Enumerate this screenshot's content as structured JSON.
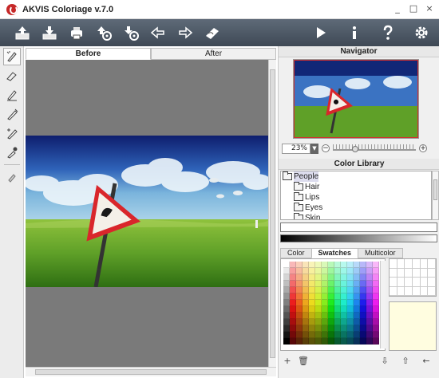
{
  "window": {
    "title": "AKVIS Coloriage v.7.0",
    "min": "_",
    "max": "□",
    "close": "×"
  },
  "toolbar": {
    "left_icons": [
      "open-image-icon",
      "save-image-icon",
      "print-icon",
      "export-icon",
      "settings-export-icon",
      "undo-icon",
      "redo-icon",
      "eraser-icon"
    ],
    "right_icons": [
      "run-icon",
      "info-icon",
      "help-icon",
      "preferences-icon"
    ]
  },
  "tools": [
    "magic-pencil-icon",
    "eraser-tool-icon",
    "pencil-tool-icon",
    "color-brush-icon",
    "smart-brush-icon",
    "eyedropper-icon",
    "hand-tool-icon"
  ],
  "tabs": {
    "before": "Before",
    "after": "After"
  },
  "navigator": {
    "title": "Navigator",
    "zoom": "23%",
    "zoom_level": 0.23
  },
  "color_library": {
    "title": "Color Library",
    "items": [
      {
        "label": "People"
      },
      {
        "label": "Hair"
      },
      {
        "label": "Lips"
      },
      {
        "label": "Eyes"
      },
      {
        "label": "Skin"
      }
    ]
  },
  "swatches": {
    "tabs": {
      "color": "Color",
      "swatches": "Swatches",
      "multicolor": "Multicolor"
    },
    "current_color": "#fffde0"
  },
  "actions": {
    "add": "+",
    "delete": "🗑",
    "import": "⇩",
    "export": "⇧",
    "back": "←"
  }
}
